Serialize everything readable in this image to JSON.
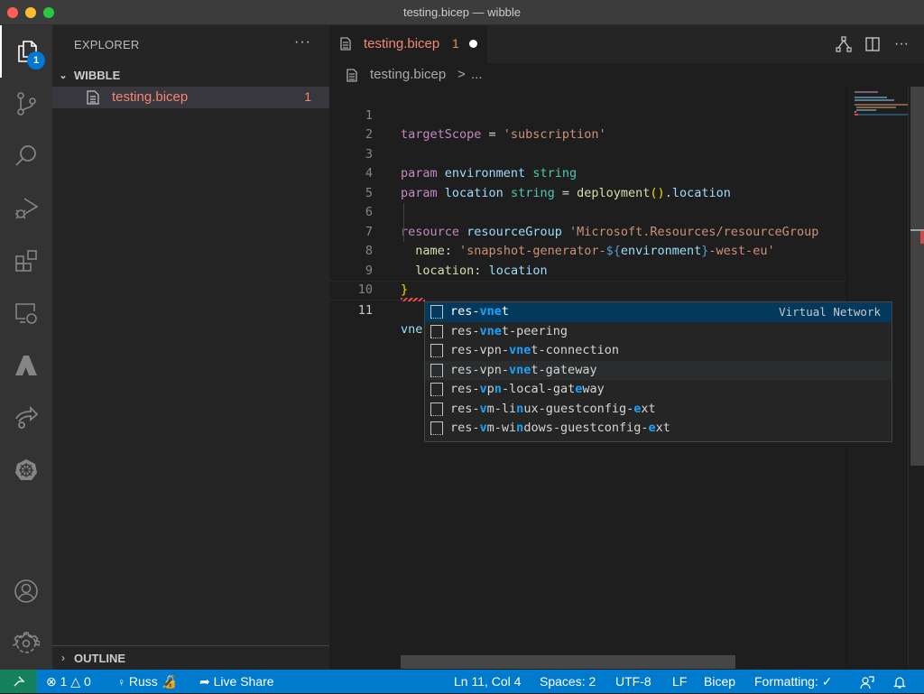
{
  "window": {
    "title": "testing.bicep — wibble"
  },
  "activity_bar": {
    "items": [
      {
        "name": "explorer",
        "icon": "files-icon",
        "badge": "1",
        "active": true
      },
      {
        "name": "source-control",
        "icon": "source-control-icon"
      },
      {
        "name": "search",
        "icon": "search-icon"
      },
      {
        "name": "run-debug",
        "icon": "run-debug-icon"
      },
      {
        "name": "extensions",
        "icon": "extensions-icon"
      },
      {
        "name": "remote-explorer",
        "icon": "remote-explorer-icon"
      },
      {
        "name": "azure",
        "icon": "azure-icon"
      },
      {
        "name": "live-share",
        "icon": "live-share-icon"
      },
      {
        "name": "kubernetes",
        "icon": "kubernetes-icon"
      }
    ],
    "bottom": [
      {
        "name": "accounts",
        "icon": "account-icon"
      },
      {
        "name": "manage",
        "icon": "gear-icon"
      }
    ]
  },
  "sidebar": {
    "title": "EXPLORER",
    "more": "···",
    "folder": "WIBBLE",
    "files": [
      {
        "name": "testing.bicep",
        "problems": "1"
      }
    ],
    "outline": "OUTLINE"
  },
  "editor": {
    "tab": {
      "name": "testing.bicep",
      "problems": "1",
      "dirty": true
    },
    "breadcrumb": {
      "file": "testing.bicep",
      "separator": ">",
      "more": "..."
    },
    "current_line": 11,
    "lines": [
      {
        "n": "1"
      },
      {
        "n": "2"
      },
      {
        "n": "3"
      },
      {
        "n": "4"
      },
      {
        "n": "5"
      },
      {
        "n": "6"
      },
      {
        "n": "7"
      },
      {
        "n": "8"
      },
      {
        "n": "9"
      },
      {
        "n": "10"
      },
      {
        "n": "11"
      }
    ],
    "code": {
      "l1": [
        "targetScope",
        " = ",
        "'subscription'"
      ],
      "l3": [
        "param",
        " ",
        "environment",
        " ",
        "string"
      ],
      "l4": [
        "param",
        " ",
        "location",
        " ",
        "string",
        " = ",
        "deployment",
        "(",
        ")",
        ".",
        "location"
      ],
      "l6": [
        "resource",
        " ",
        "resourceGroup",
        " ",
        "'Microsoft.Resources/resourceGroup"
      ],
      "l7": [
        "  ",
        "name",
        ": ",
        "'snapshot-generator-",
        "${",
        "environment",
        "}",
        "-west-eu'"
      ],
      "l8": [
        "  ",
        "location",
        ": ",
        "location"
      ],
      "l9": [
        "}"
      ],
      "l11": [
        "vne"
      ]
    }
  },
  "suggestions": [
    {
      "parts": [
        "res-",
        "vne",
        "t"
      ],
      "hl": [
        1
      ],
      "detail": "Virtual Network",
      "selected": true
    },
    {
      "parts": [
        "res-",
        "vne",
        "t-peering"
      ],
      "hl": [
        1
      ]
    },
    {
      "parts": [
        "res-vpn-",
        "vne",
        "t-connection"
      ],
      "hl": [
        1
      ]
    },
    {
      "parts": [
        "res-vpn-",
        "vne",
        "t-gateway"
      ],
      "hl": [
        1
      ],
      "hovered": true
    },
    {
      "parts": [
        "res-",
        "v",
        "p",
        "n",
        "-local-gat",
        "e",
        "way"
      ],
      "hl": [
        1,
        3,
        5
      ]
    },
    {
      "parts": [
        "res-",
        "v",
        "m-li",
        "n",
        "ux-guestconfig-",
        "e",
        "xt"
      ],
      "hl": [
        1,
        3,
        5
      ]
    },
    {
      "parts": [
        "res-",
        "v",
        "m-wi",
        "n",
        "dows-guestconfig-",
        "e",
        "xt"
      ],
      "hl": [
        1,
        3,
        5
      ]
    }
  ],
  "statusbar": {
    "errors": "1",
    "warnings": "0",
    "user": "Russ",
    "live_share": "Live Share",
    "position": "Ln 11, Col 4",
    "spaces": "Spaces: 2",
    "encoding": "UTF-8",
    "eol": "LF",
    "language": "Bicep",
    "formatting": "Formatting: ✓"
  },
  "colors": {
    "accent": "#007acc",
    "remote": "#16825d",
    "error_text": "#f48771",
    "match_highlight": "#18a3ff",
    "selected_suggestion": "#04395e"
  }
}
